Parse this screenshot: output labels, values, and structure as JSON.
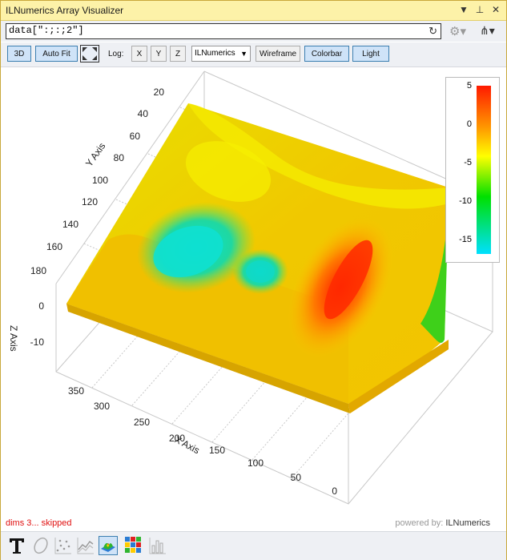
{
  "window": {
    "title": "ILNumerics Array Visualizer",
    "menu_glyph": "▼",
    "pin_glyph": "⊥",
    "close_glyph": "✕"
  },
  "expression": {
    "value": "data[\":;:;2\"]",
    "refresh_icon": "refresh-icon"
  },
  "toolbar": {
    "btn_3d": "3D",
    "btn_autofit": "Auto Fit",
    "log_label": "Log:",
    "log_x": "X",
    "log_y": "Y",
    "log_z": "Z",
    "colormap_value": "ILNumerics",
    "btn_wireframe": "Wireframe",
    "btn_colorbar": "Colorbar",
    "btn_light": "Light"
  },
  "plot": {
    "y_axis_label": "Y Axis",
    "x_axis_label": "X Axis",
    "z_axis_label": "Z Axis",
    "y_ticks": [
      "20",
      "40",
      "60",
      "80",
      "100",
      "120",
      "140",
      "160",
      "180"
    ],
    "x_ticks": [
      "350",
      "300",
      "250",
      "200",
      "150",
      "100",
      "50",
      "0"
    ],
    "z_ticks": [
      "0",
      "-10"
    ],
    "colorbar_ticks": [
      "5",
      "0",
      "-5",
      "-10",
      "-15"
    ],
    "colors": {
      "max": "#ff1a00",
      "high": "#ff9900",
      "mid": "#ffff00",
      "low": "#00e000",
      "min": "#00e0ff"
    }
  },
  "status": {
    "message": "dims 3... skipped",
    "powered_prefix": "powered by:",
    "powered_name": "ILNumerics"
  }
}
